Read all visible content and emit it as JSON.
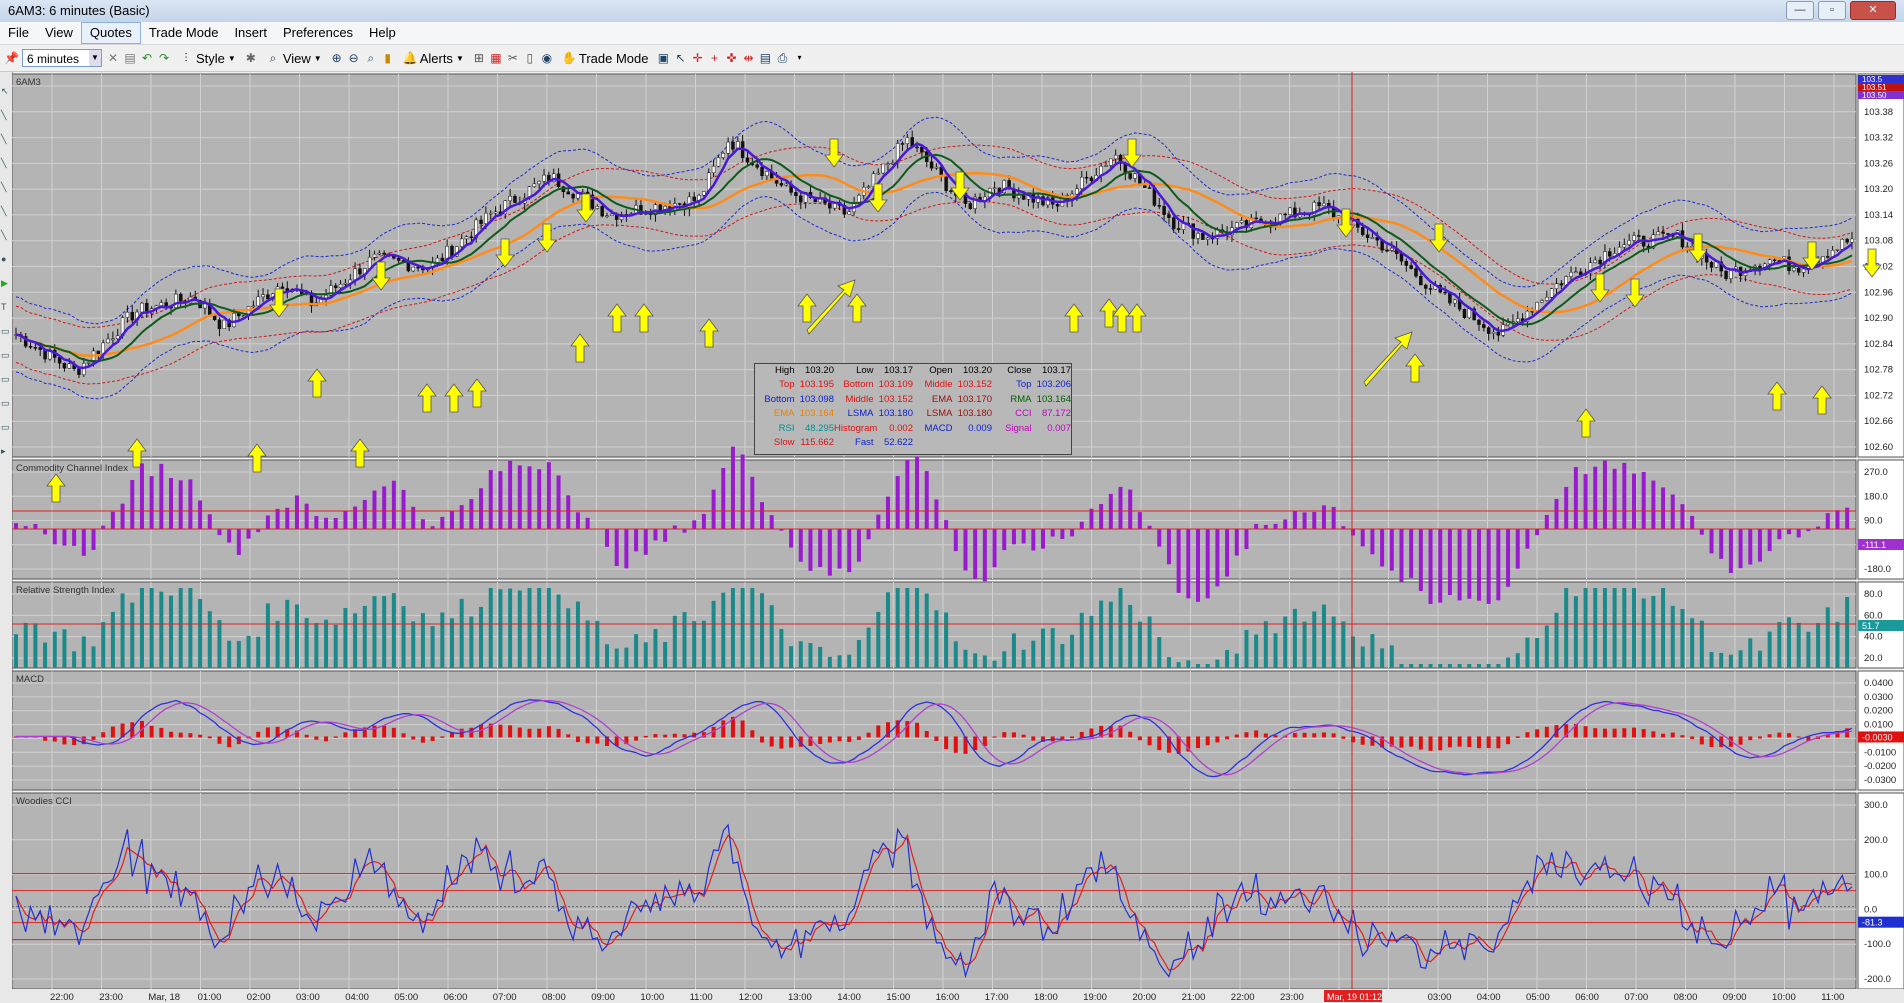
{
  "window": {
    "title": "6AM3: 6 minutes (Basic)",
    "minimize": "—",
    "maximize": "▫",
    "close": "✕"
  },
  "menu": [
    "File",
    "View",
    "Quotes",
    "Trade Mode",
    "Insert",
    "Preferences",
    "Help"
  ],
  "toolbar": {
    "interval": "6 minutes",
    "style_label": "Style",
    "view_label": "View",
    "alerts_label": "Alerts",
    "trade_mode_label": "Trade Mode"
  },
  "colors": {
    "pane_bg": "#b4b4b4",
    "grid": "#d0d0d0",
    "price_ema": "#ff8c1a",
    "purple_ma": "#4a18d8",
    "green_ma": "#0f5a1a",
    "bollinger_blue": "#1a2ad0",
    "bollinger_red": "#d01818",
    "cci_bar": "#9a1ad0",
    "rsi_bar": "#1a8a8a",
    "macd_hist": "#e01010",
    "arrow": "#ffff00",
    "crosshair": "#e02020"
  },
  "panes": {
    "price": {
      "name": "6AM3",
      "ticks": [
        "103.44",
        "103.38",
        "103.32",
        "103.26",
        "103.20",
        "103.14",
        "103.08",
        "103.02",
        "102.96",
        "102.90",
        "102.84",
        "102.78",
        "102.72",
        "102.66",
        "102.60"
      ],
      "badges": [
        "103.5",
        "103.51",
        "103.50"
      ]
    },
    "cci": {
      "name": "Commodity Channel Index",
      "ticks": [
        "270.0",
        "180.0",
        "90.0",
        "0.0",
        "-180.0"
      ],
      "badge": "-111.1"
    },
    "rsi": {
      "name": "Relative Strength Index",
      "ticks": [
        "80.0",
        "60.0",
        "40.0",
        "20.0"
      ],
      "badge": "51.7"
    },
    "macd": {
      "name": "MACD",
      "ticks": [
        "0.0400",
        "0.0300",
        "0.0200",
        "0.0100",
        "0.0000",
        "-0.0100",
        "-0.0200",
        "-0.0300"
      ],
      "badge": "-0.0030"
    },
    "woodies": {
      "name": "Woodies CCI",
      "ticks": [
        "300.0",
        "200.0",
        "100.0",
        "0.0",
        "-100.0",
        "-200.0"
      ],
      "badge": "-81.3"
    }
  },
  "time_axis": [
    "22:00",
    "23:00",
    "Mar, 18",
    "01:00",
    "02:00",
    "03:00",
    "04:00",
    "05:00",
    "06:00",
    "07:00",
    "08:00",
    "09:00",
    "10:00",
    "11:00",
    "12:00",
    "13:00",
    "14:00",
    "15:00",
    "16:00",
    "17:00",
    "18:00",
    "19:00",
    "20:00",
    "21:00",
    "22:00",
    "23:00",
    "Mar, 19",
    "Mar, 19 01:12",
    "03:00",
    "04:00",
    "05:00",
    "06:00",
    "07:00",
    "08:00",
    "09:00",
    "10:00",
    "11:00"
  ],
  "crosshair_time": "Mar, 19 01:12",
  "ohlc_box": [
    [
      [
        "High",
        "k-black"
      ],
      [
        "103.20",
        "k-black"
      ],
      [
        "Low",
        "k-black"
      ],
      [
        "103.17",
        "k-black"
      ],
      [
        "Open",
        "k-black"
      ],
      [
        "103.20",
        "k-black"
      ],
      [
        "Close",
        "k-black"
      ],
      [
        "103.17",
        "k-black"
      ]
    ],
    [
      [
        "Top",
        "k-red"
      ],
      [
        "103.195",
        "k-red"
      ],
      [
        "Bottom",
        "k-red"
      ],
      [
        "103.109",
        "k-red"
      ],
      [
        "Middle",
        "k-red"
      ],
      [
        "103.152",
        "k-red"
      ],
      [
        "Top",
        "k-blue"
      ],
      [
        "103.206",
        "k-blue"
      ]
    ],
    [
      [
        "Bottom",
        "k-blue"
      ],
      [
        "103.098",
        "k-blue"
      ],
      [
        "Middle",
        "k-red"
      ],
      [
        "103.152",
        "k-red"
      ],
      [
        "EMA",
        "k-darkred"
      ],
      [
        "103.170",
        "k-darkred"
      ],
      [
        "RMA",
        "k-green"
      ],
      [
        "103.164",
        "k-green"
      ]
    ],
    [
      [
        "EMA",
        "k-orange"
      ],
      [
        "103.164",
        "k-orange"
      ],
      [
        "LSMA",
        "k-blue"
      ],
      [
        "103.180",
        "k-blue"
      ],
      [
        "LSMA",
        "k-darkred"
      ],
      [
        "103.180",
        "k-darkred"
      ],
      [
        "CCI",
        "k-magenta"
      ],
      [
        "87.172",
        "k-magenta"
      ]
    ],
    [
      [
        "RSI",
        "k-teal"
      ],
      [
        "48.295",
        "k-teal"
      ],
      [
        "Histogram",
        "k-red"
      ],
      [
        "0.002",
        "k-red"
      ],
      [
        "MACD",
        "k-blue"
      ],
      [
        "0.009",
        "k-blue"
      ],
      [
        "Signal",
        "k-magenta"
      ],
      [
        "0.007",
        "k-magenta"
      ]
    ],
    [
      [
        "Slow",
        "k-red"
      ],
      [
        "115.662",
        "k-red"
      ],
      [
        "Fast",
        "k-blue"
      ],
      [
        "52.622",
        "k-blue"
      ],
      [
        "",
        "k-black"
      ],
      [
        "",
        "k-black"
      ],
      [
        "",
        "k-black"
      ],
      [
        "",
        "k-black"
      ]
    ]
  ]
}
